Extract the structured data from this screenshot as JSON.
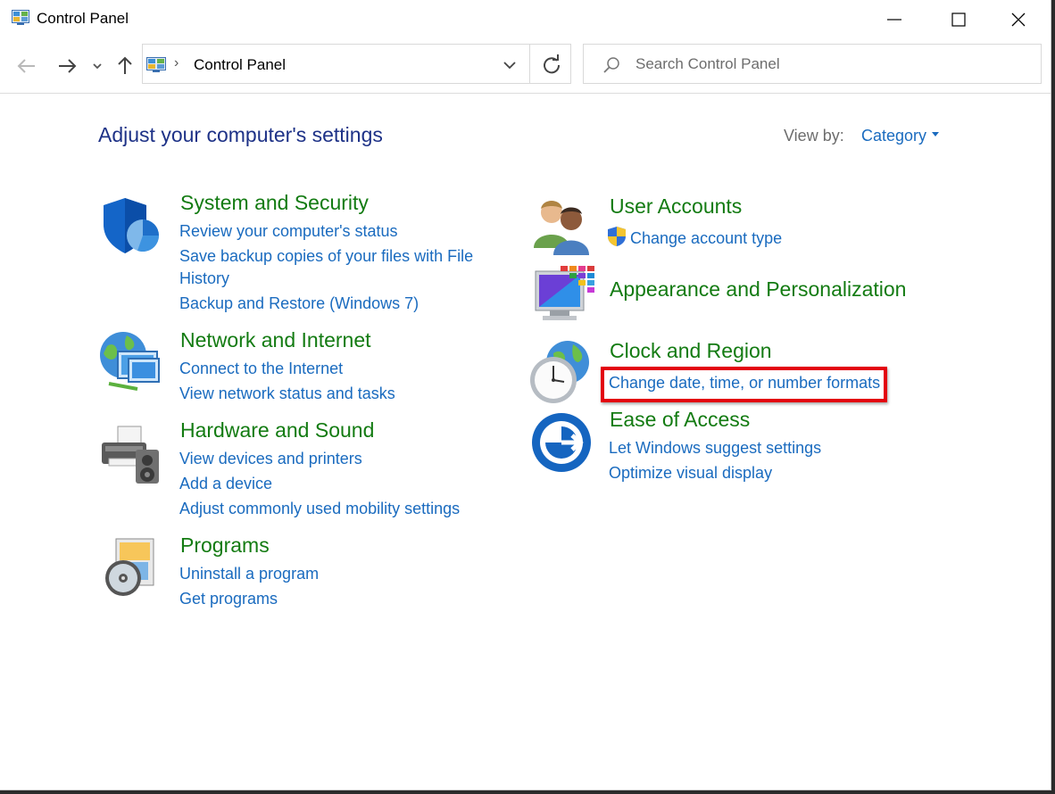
{
  "window": {
    "title": "Control Panel"
  },
  "address_bar": {
    "path": "Control Panel"
  },
  "search": {
    "placeholder": "Search Control Panel"
  },
  "page": {
    "heading": "Adjust your computer's settings",
    "view_by_label": "View by:",
    "view_by_value": "Category"
  },
  "categories": {
    "system_security": {
      "title": "System and Security",
      "links": [
        "Review your computer's status",
        "Save backup copies of your files with File",
        "History",
        "Backup and Restore (Windows 7)"
      ]
    },
    "network_internet": {
      "title": "Network and Internet",
      "links": [
        "Connect to the Internet",
        "View network status and tasks"
      ]
    },
    "hardware_sound": {
      "title": "Hardware and Sound",
      "links": [
        "View devices and printers",
        "Add a device",
        "Adjust commonly used mobility settings"
      ]
    },
    "programs": {
      "title": "Programs",
      "links": [
        "Uninstall a program",
        "Get programs"
      ]
    },
    "user_accounts": {
      "title": "User Accounts",
      "links": [
        "Change account type"
      ]
    },
    "appearance": {
      "title": "Appearance and Personalization",
      "links": []
    },
    "clock_region": {
      "title": "Clock and Region",
      "links": [
        "Change date, time, or number formats"
      ]
    },
    "ease_of_access": {
      "title": "Ease of Access",
      "links": [
        "Let Windows suggest settings",
        "Optimize visual display"
      ]
    }
  },
  "colors": {
    "category_title": "#137b12",
    "link": "#1a6bbf",
    "heading": "#1e3287",
    "highlight_box": "#e3000f"
  }
}
